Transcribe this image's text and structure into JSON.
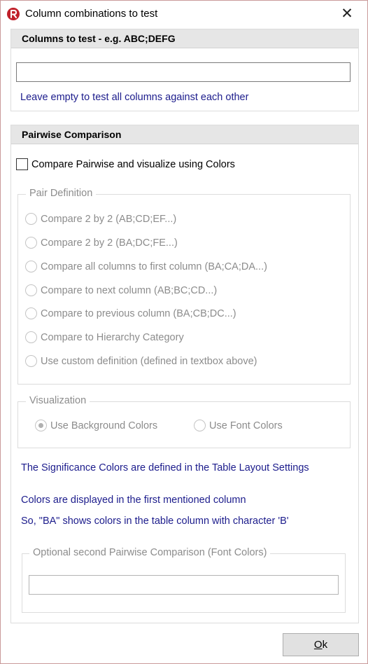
{
  "window": {
    "title": "Column combinations to test",
    "icon": "app-logo-icon",
    "close_glyph": "✕"
  },
  "columns_panel": {
    "header": "Columns to test - e.g. ABC;DEFG",
    "input_value": "",
    "note": "Leave empty to test all columns against each other"
  },
  "pairwise_panel": {
    "header": "Pairwise Comparison",
    "compare_checkbox_label": "Compare Pairwise and visualize using Colors",
    "compare_checked": false,
    "pair_definition": {
      "legend": "Pair Definition",
      "options": [
        {
          "label": "Compare 2 by 2 (AB;CD;EF...)",
          "checked": false
        },
        {
          "label": "Compare 2 by 2 (BA;DC;FE...)",
          "checked": false
        },
        {
          "label": "Compare all columns to first column (BA;CA;DA...)",
          "checked": false
        },
        {
          "label": "Compare to next column (AB;BC;CD...)",
          "checked": false
        },
        {
          "label": "Compare to previous column (BA;CB;DC...)",
          "checked": false
        },
        {
          "label": "Compare to Hierarchy Category",
          "checked": false
        },
        {
          "label": "Use custom definition (defined in textbox above)",
          "checked": false
        }
      ]
    },
    "visualization": {
      "legend": "Visualization",
      "background_label": "Use Background Colors",
      "background_checked": true,
      "font_label": "Use Font Colors",
      "font_checked": false
    },
    "notes": {
      "significance": "The Significance Colors are defined in the Table Layout Settings",
      "first_column": "Colors are displayed in the first mentioned column",
      "example": "So, \"BA\" shows colors in the table column with character 'B'"
    },
    "optional": {
      "legend": "Optional second Pairwise Comparison (Font Colors)",
      "input_value": ""
    }
  },
  "ok_button": {
    "mnemonic": "O",
    "rest": "k"
  },
  "colors": {
    "note_blue": "#1c1c8c",
    "disabled_gray": "#8c8c8c",
    "header_bg": "#e6e6e6",
    "icon_red": "#c0202a"
  }
}
